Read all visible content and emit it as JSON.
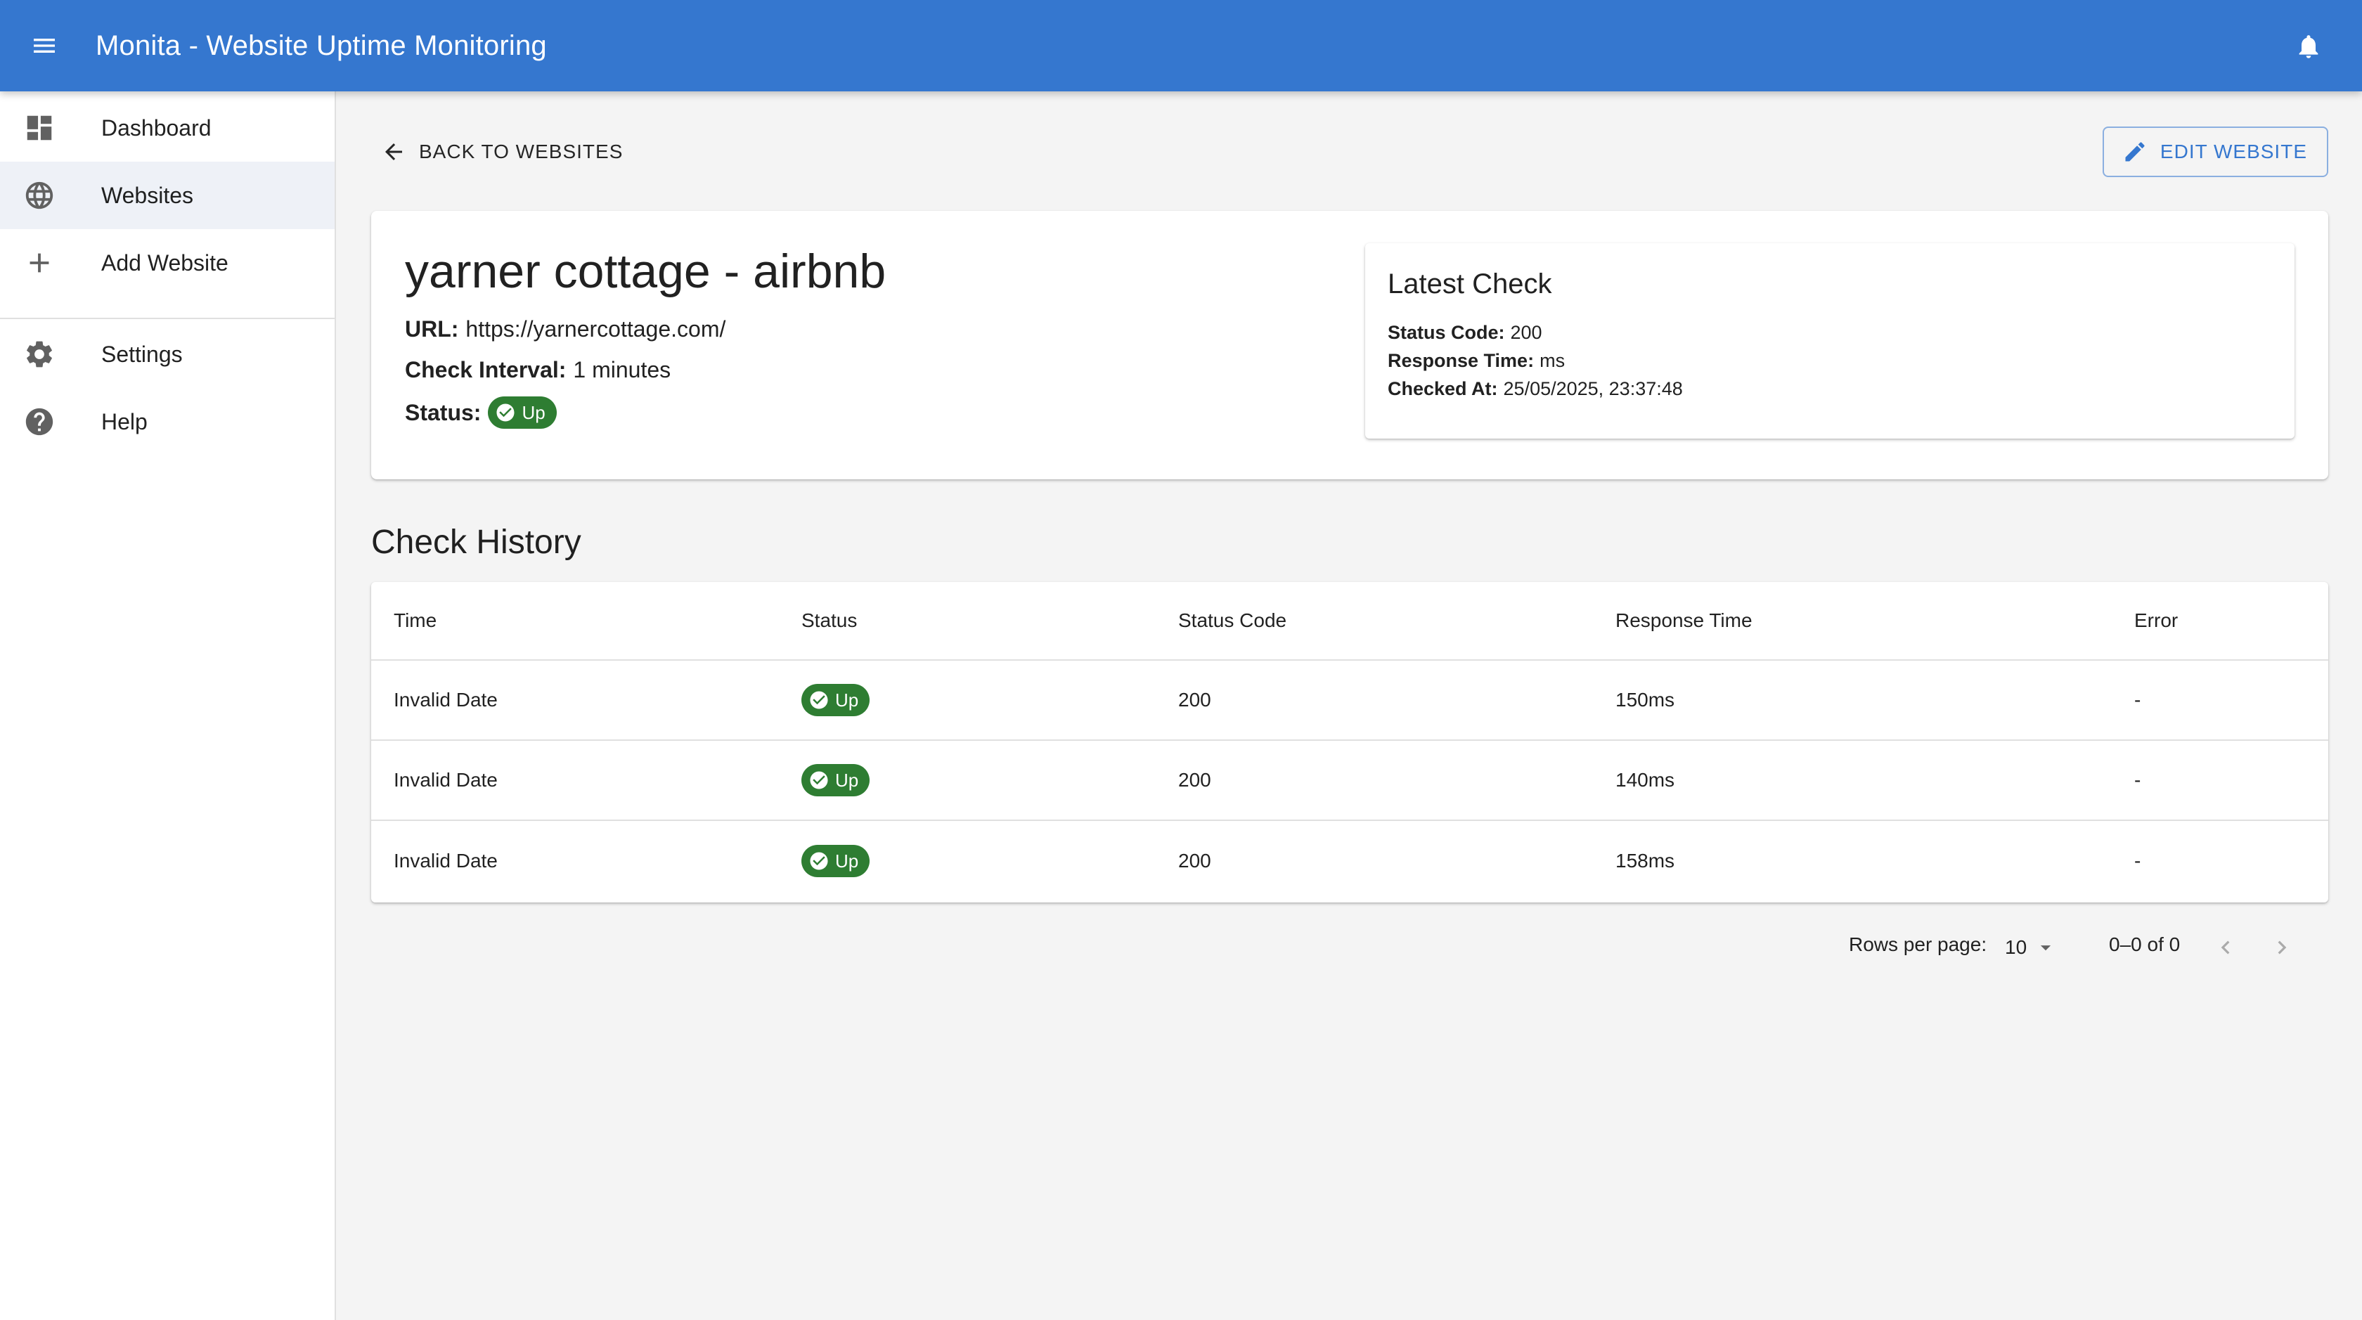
{
  "app": {
    "title": "Monita - Website Uptime Monitoring",
    "accent_color": "#3577cf",
    "up_color": "#2e7d32"
  },
  "sidebar": {
    "items": [
      {
        "label": "Dashboard",
        "icon": "dashboard-icon",
        "active": false
      },
      {
        "label": "Websites",
        "icon": "globe-icon",
        "active": true
      },
      {
        "label": "Add Website",
        "icon": "plus-icon",
        "active": false
      },
      {
        "label": "Settings",
        "icon": "gear-icon",
        "active": false
      },
      {
        "label": "Help",
        "icon": "help-icon",
        "active": false
      }
    ]
  },
  "toolbar": {
    "back_label": "BACK TO WEBSITES",
    "edit_label": "EDIT WEBSITE"
  },
  "website": {
    "name": "yarner cottage - airbnb",
    "url_label": "URL:",
    "url": "https://yarnercottage.com/",
    "interval_label": "Check Interval:",
    "interval": "1 minutes",
    "status_label": "Status:",
    "status": "Up"
  },
  "latest_check": {
    "title": "Latest Check",
    "status_code_label": "Status Code:",
    "status_code": "200",
    "response_time_label": "Response Time:",
    "response_time": "ms",
    "checked_at_label": "Checked At:",
    "checked_at": "25/05/2025, 23:37:48"
  },
  "history": {
    "title": "Check History",
    "columns": [
      "Time",
      "Status",
      "Status Code",
      "Response Time",
      "Error"
    ],
    "rows": [
      {
        "time": "Invalid Date",
        "status": "Up",
        "status_code": "200",
        "response_time": "150ms",
        "error": "-"
      },
      {
        "time": "Invalid Date",
        "status": "Up",
        "status_code": "200",
        "response_time": "140ms",
        "error": "-"
      },
      {
        "time": "Invalid Date",
        "status": "Up",
        "status_code": "200",
        "response_time": "158ms",
        "error": "-"
      }
    ]
  },
  "pagination": {
    "rows_per_page_label": "Rows per page:",
    "rows_per_page": "10",
    "range": "0–0 of 0"
  }
}
